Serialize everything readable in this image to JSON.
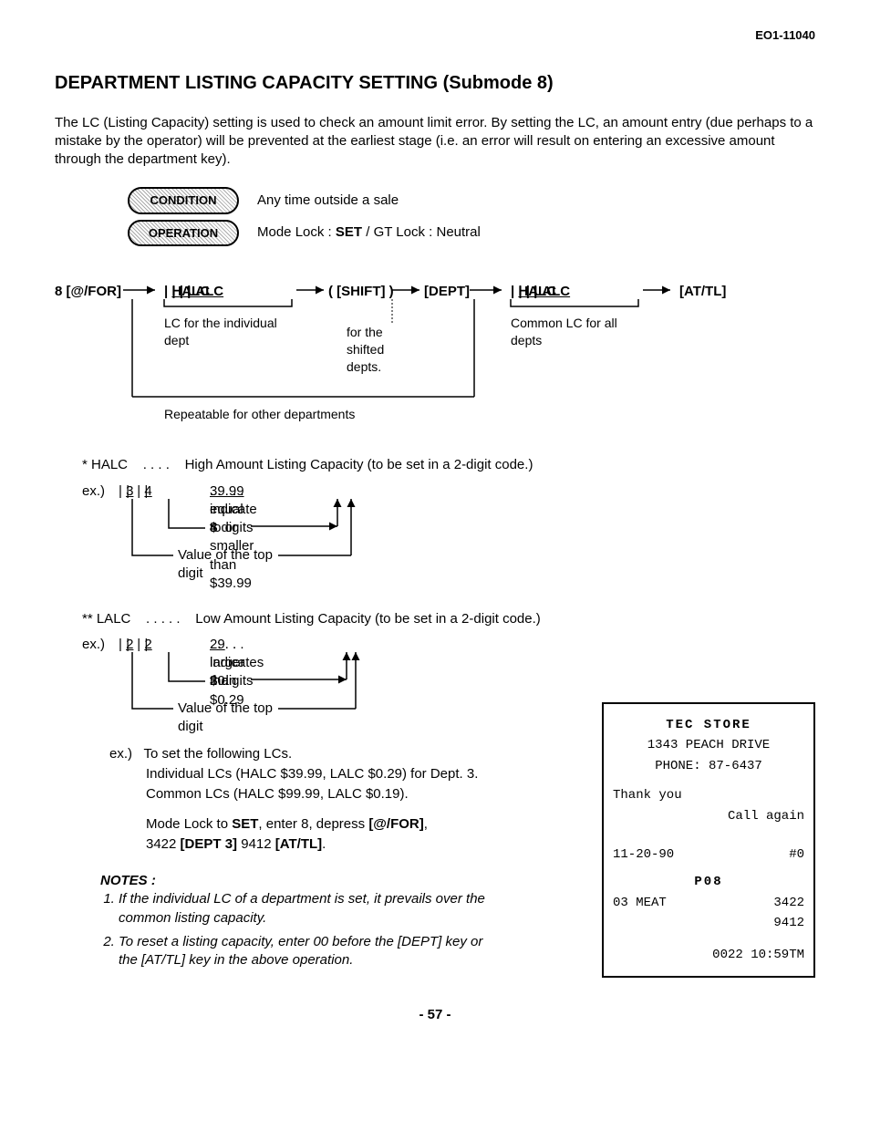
{
  "doc_id": "EO1-11040",
  "title": "DEPARTMENT LISTING CAPACITY SETTING  (Submode 8)",
  "intro": "The LC (Listing Capacity) setting is used to check an amount limit error.   By setting the LC, an amount entry (due perhaps to a mistake by the operator) will be prevented at the earliest stage (i.e. an error will result on entering an excessive amount through the department key).",
  "condition": {
    "label": "CONDITION",
    "text": "Any time outside a sale"
  },
  "operation": {
    "label": "OPERATION",
    "text_pre": "Mode Lock :  ",
    "text_bold": "SET",
    "text_post": " / GT Lock : Neutral"
  },
  "flow": {
    "start": "8 [@/FOR]",
    "halc": "HALC",
    "lalc": "LALC",
    "shift": "( [SHIFT] )",
    "dept": "[DEPT]",
    "attl": "[AT/TL]",
    "note1": "LC for the individual dept",
    "note2": "for the shifted depts.",
    "note3": "Common LC for all depts",
    "repeat": "Repeatable for other departments"
  },
  "halc_def": {
    "label": "* HALC",
    "dots": ". . . .",
    "text": "High Amount Listing Capacity (to be set in a 2-digit code.)"
  },
  "halc_ex": {
    "prefix": "ex.)",
    "d1": "3",
    "d2": "4",
    "indicate": ". . . .   indicate $",
    "amount": "39.99",
    "rest": " . . . . .    equal to or smaller than $39.99",
    "anno1": "4 digits",
    "anno2": "Value of the top digit"
  },
  "lalc_def": {
    "label": "** LALC",
    "dots": ". . . . .",
    "text": "Low Amount Listing Capacity (to be set in a 2-digit code.)"
  },
  "lalc_ex": {
    "prefix": "ex.)",
    "d1": "2",
    "d2": "2",
    "indicate": ". . . .   indicates $0.",
    "amount": "29",
    "rest": " . . . . .    larger than $0.29",
    "anno1": "2 digits",
    "anno2": "Value of the top digit"
  },
  "set_ex": {
    "prefix": "ex.)",
    "l1": "To set the following LCs.",
    "l2": "Individual LCs (HALC $39.99, LALC $0.29) for Dept. 3.",
    "l3": "Common LCs (HALC $99.99, LALC $0.19).",
    "l4a": "Mode Lock to ",
    "l4b": "SET",
    "l4c": ", enter 8, depress ",
    "l4d": "[@/FOR]",
    "l4e": ",",
    "l5a": "3422 ",
    "l5b": "[DEPT 3]",
    "l5c": " 9412 ",
    "l5d": "[AT/TL]",
    "l5e": "."
  },
  "notes": {
    "label": "NOTES :",
    "n1": "If the individual LC of a department is set, it prevails over the common listing capacity.",
    "n2": "To reset a listing capacity, enter 00 before the [DEPT] key or the [AT/TL] key in the above operation."
  },
  "receipt": {
    "store": "TEC  STORE",
    "addr": "1343 PEACH DRIVE",
    "phone": "PHONE: 87-6437",
    "thank": "Thank you",
    "call": "Call again",
    "date": "11-20-90",
    "reg": "#0",
    "mode": "P08",
    "item": "03 MEAT",
    "v1": "3422",
    "v2": "9412",
    "seq": "0022",
    "time": "10:59TM"
  },
  "page": "- 57 -"
}
